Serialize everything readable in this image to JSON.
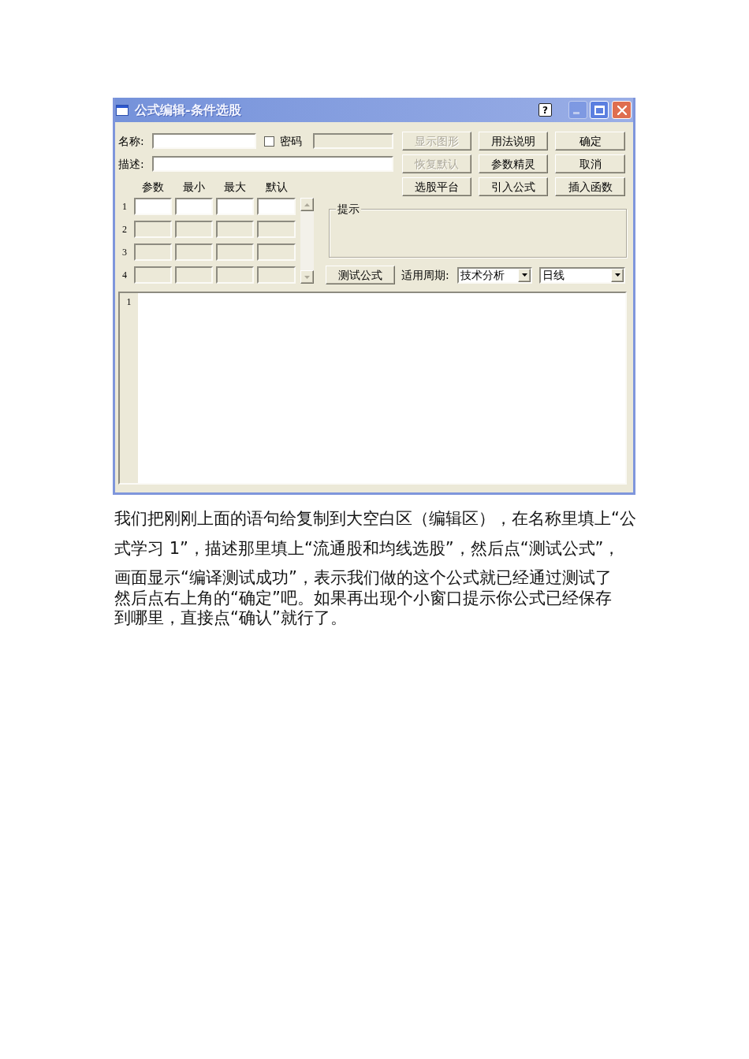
{
  "window": {
    "title": "公式编辑-条件选股",
    "title_buttons": [
      {
        "kind": "help",
        "label": "?",
        "disabled": false
      },
      {
        "kind": "minimize",
        "disabled": true
      },
      {
        "kind": "maximize",
        "disabled": false
      },
      {
        "kind": "close",
        "disabled": false
      }
    ]
  },
  "form": {
    "name": {
      "label": "名称:"
    },
    "password": {
      "label": "密码",
      "checked": false
    },
    "password_field": {
      "disabled": true
    },
    "description": {
      "label": "描述:"
    }
  },
  "buttons": [
    {
      "label": "显示图形",
      "disabled": true
    },
    {
      "label": "用法说明",
      "disabled": false
    },
    {
      "label": "确定",
      "disabled": false
    },
    {
      "label": "恢复默认",
      "disabled": true
    },
    {
      "label": "参数精灵",
      "disabled": false
    },
    {
      "label": "取消",
      "disabled": false
    },
    {
      "label": "选股平台",
      "disabled": false
    },
    {
      "label": "引入公式",
      "disabled": false
    },
    {
      "label": "插入函数",
      "disabled": false
    }
  ],
  "params": {
    "columns": [
      "参数",
      "最小",
      "最大",
      "默认"
    ],
    "rows": [
      {
        "number": "1",
        "disabled": false
      },
      {
        "number": "2",
        "disabled": true
      },
      {
        "number": "3",
        "disabled": true
      },
      {
        "number": "4",
        "disabled": true
      }
    ]
  },
  "hint": {
    "label": "提示"
  },
  "test_button": {
    "label": "测试公式"
  },
  "period": {
    "label": "适用周期:",
    "dropdowns": [
      {
        "value": "技术分析"
      },
      {
        "value": "日线"
      }
    ]
  },
  "editor": {
    "line_numbers": [
      "1"
    ]
  },
  "paragraphs": [
    {
      "lines": [
        "我们把刚刚上面的语句给复制到大空白区（编辑区），在名称里填上“公",
        "式学习 1”，描述那里填上“流通股和均线选股”，然后点“测试公式”，",
        "画面显示“编译测试成功”，表示我们做的这个公式就已经通过测试了"
      ]
    },
    {
      "lines": [
        "然后点右上角的“确定”吧。如果再出现个小窗口提示你公式已经保存",
        "到哪里，直接点“确认”就行了。"
      ]
    }
  ]
}
